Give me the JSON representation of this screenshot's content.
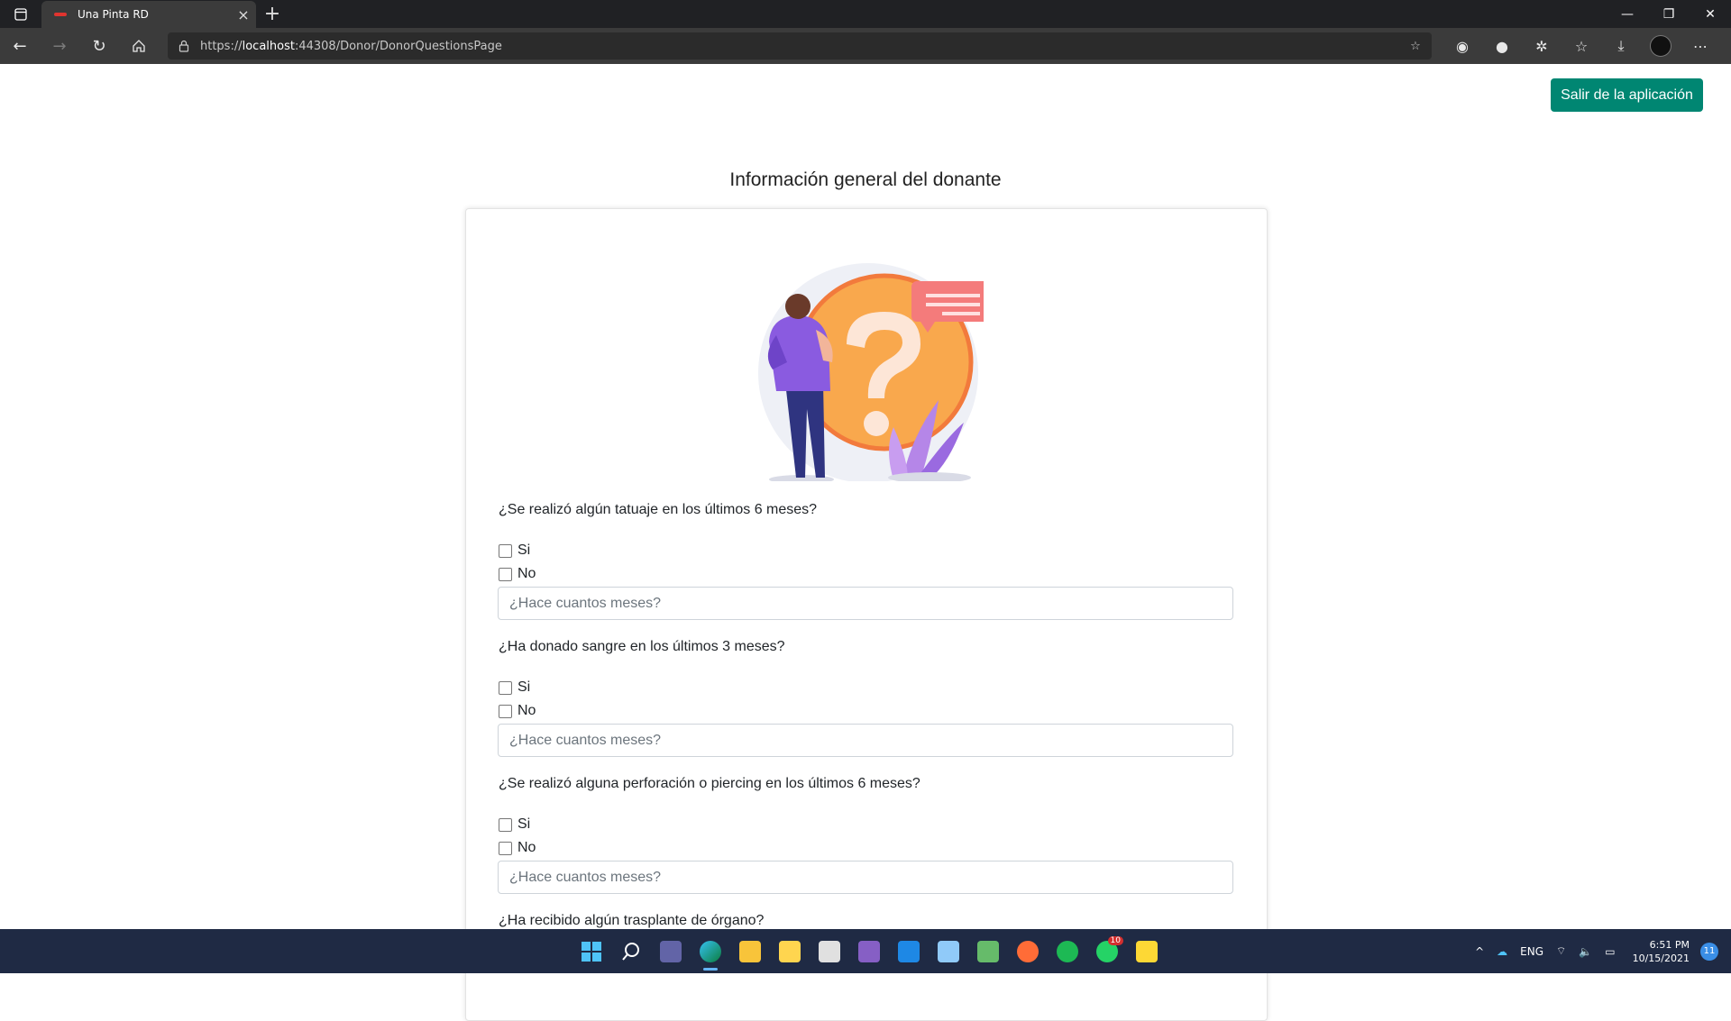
{
  "browser": {
    "tab_title": "Una Pinta RD",
    "url_prefix": "https://",
    "url_host": "localhost",
    "url_rest": ":44308/Donor/DonorQuestionsPage"
  },
  "header": {
    "exit_button": "Salir de la aplicación",
    "page_title": "Información general del donante"
  },
  "questions": [
    {
      "text": "¿Se realizó algún tatuaje en los últimos 6 meses?",
      "yes": "Si",
      "no": "No",
      "placeholder": "¿Hace cuantos meses?"
    },
    {
      "text": "¿Ha donado sangre en los últimos 3 meses?",
      "yes": "Si",
      "no": "No",
      "placeholder": "¿Hace cuantos meses?"
    },
    {
      "text": "¿Se realizó alguna perforación o piercing en los últimos 6 meses?",
      "yes": "Si",
      "no": "No",
      "placeholder": "¿Hace cuantos meses?"
    },
    {
      "text": "¿Ha recibido algún trasplante de órgano?"
    }
  ],
  "taskbar": {
    "language": "ENG",
    "time": "6:51 PM",
    "date": "10/15/2021",
    "notifications": "11",
    "whatsapp_badge": "10"
  },
  "colors": {
    "accent": "#008672",
    "browser_dark": "#202124",
    "taskbar": "#1f2a44"
  }
}
